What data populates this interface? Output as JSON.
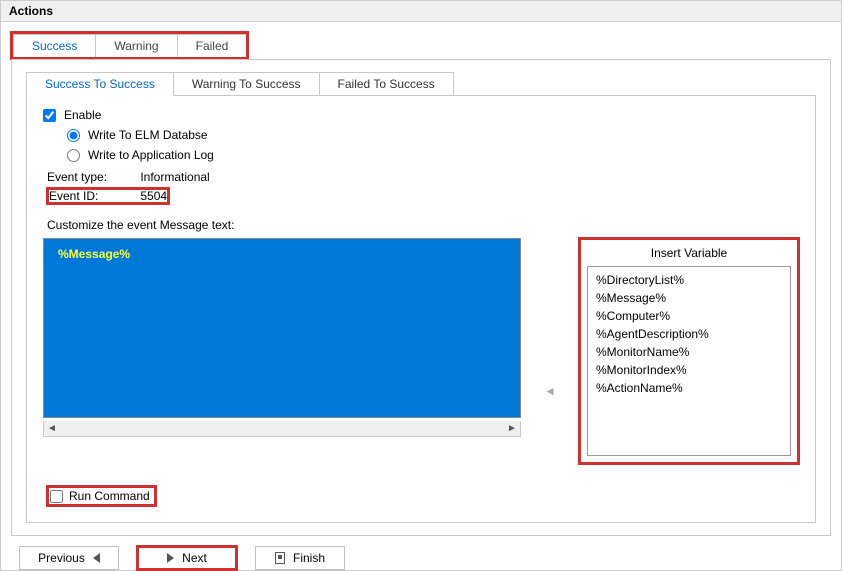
{
  "title": "Actions",
  "outer_tabs": {
    "success": "Success",
    "warning": "Warning",
    "failed": "Failed"
  },
  "inner_tabs": {
    "s2s": "Success To Success",
    "w2s": "Warning To Success",
    "f2s": "Failed To Success"
  },
  "enable_label": "Enable",
  "enable_checked": true,
  "radio": {
    "elm": "Write To ELM Databse",
    "applog": "Write to Application Log"
  },
  "event_type_label": "Event type:",
  "event_type_value": "Informational",
  "event_id_label": "Event ID:",
  "event_id_value": "5504",
  "customize_label": "Customize the event Message text:",
  "message_text": "%Message%",
  "insert_variable_title": "Insert Variable",
  "variables": [
    "%DirectoryList%",
    "%Message%",
    "%Computer%",
    "%AgentDescription%",
    "%MonitorName%",
    "%MonitorIndex%",
    "%ActionName%"
  ],
  "run_command_label": "Run Command",
  "buttons": {
    "previous": "Previous",
    "next": "Next",
    "finish": "Finish"
  }
}
